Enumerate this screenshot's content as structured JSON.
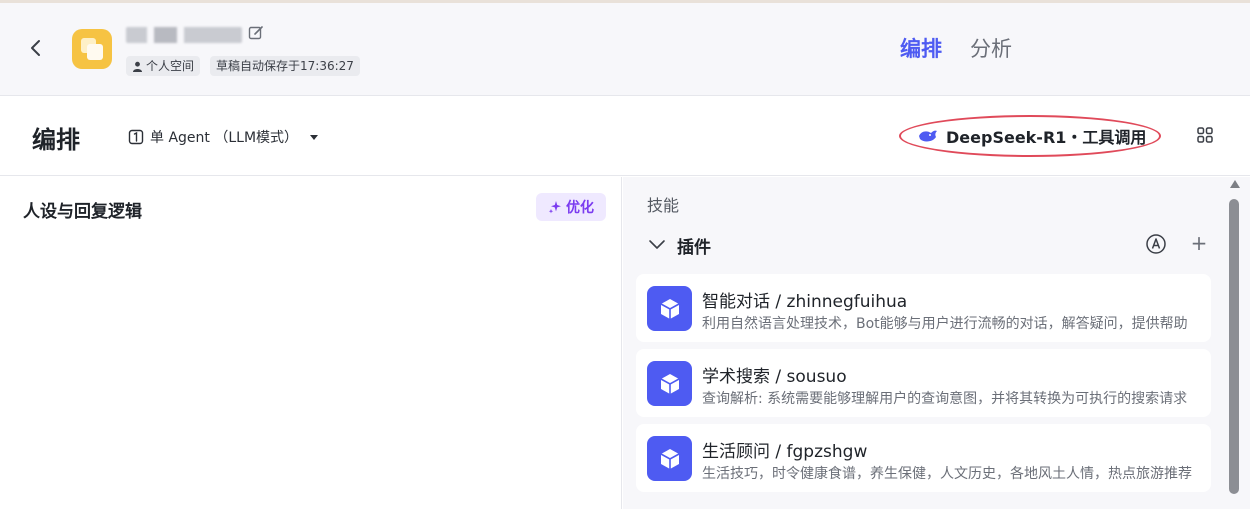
{
  "header": {
    "tags": {
      "personal_space": "个人空间",
      "autosave": "草稿自动保存于17:36:27"
    },
    "tabs": [
      {
        "label": "编排",
        "active": true
      },
      {
        "label": "分析",
        "active": false
      }
    ]
  },
  "toolbar": {
    "title": "编排",
    "mode_label": "单 Agent （LLM模式）",
    "model_label": "DeepSeek-R1・工具调用"
  },
  "persona": {
    "title": "人设与回复逻辑",
    "optimize_label": "优化"
  },
  "skills": {
    "title": "技能",
    "plugins_label": "插件",
    "plugins": [
      {
        "name": "智能对话 / zhinnegfuihua",
        "desc": "利用自然语言处理技术，Bot能够与用户进行流畅的对话，解答疑问，提供帮助"
      },
      {
        "name": "学术搜索 / sousuo",
        "desc": "查询解析: 系统需要能够理解用户的查询意图，并将其转换为可执行的搜索请求"
      },
      {
        "name": "生活顾问 / fgpzshgw",
        "desc": "生活技巧，时令健康食谱，养生保健，人文历史，各地风土人情，热点旅游推荐"
      }
    ]
  },
  "colors": {
    "accent": "#4e5bf2",
    "highlight_ring": "#e04a5a",
    "optimize_bg": "#efe9ff",
    "optimize_text": "#7b3cf0",
    "app_icon": "#f6c343"
  },
  "icons": {
    "back": "chevron-left-icon",
    "edit": "edit-icon",
    "user": "user-icon",
    "mode": "agent-mode-icon",
    "model": "deepseek-whale-icon",
    "grid": "grid-icon",
    "sparkle": "sparkle-icon",
    "collapse": "chevron-down-icon",
    "auto": "auto-icon",
    "add": "plus-icon",
    "plugin": "cube-icon"
  }
}
